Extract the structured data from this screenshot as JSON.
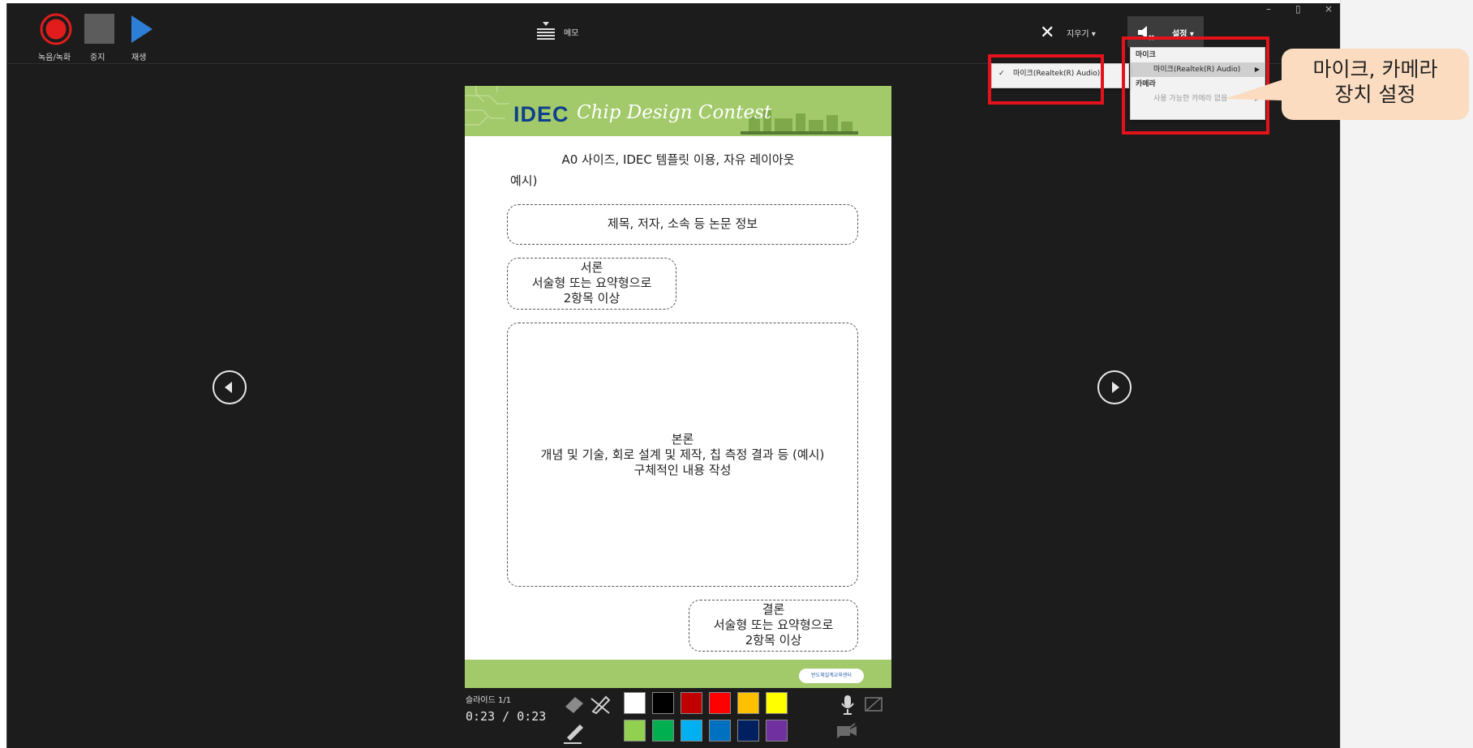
{
  "window": {
    "minimize": "–",
    "restore": "▯",
    "close": "×"
  },
  "toolbar": {
    "record_label": "녹음/녹화",
    "stop_label": "중지",
    "play_label": "재생",
    "memo_label": "메모",
    "clear_label": "지우기",
    "settings_label": "설정"
  },
  "settings_menu": {
    "mic_header": "마이크",
    "mic_item": "마이크(Realtek(R) Audio)",
    "camera_header": "카메라",
    "camera_item": "사용 가능한 카메라 없음"
  },
  "mic_submenu": {
    "checkmark": "✓",
    "item": "마이크(Realtek(R) Audio)"
  },
  "callout": {
    "line1": "마이크, 카메라",
    "line2": "장치 설정"
  },
  "slide": {
    "logo": "IDEC",
    "contest": "Chip Design Contest",
    "heading": "A0 사이즈, IDEC 템플릿 이용, 자유 레이아웃",
    "example": "예시)",
    "box_title": "제목, 저자, 소속 등 논문 정보",
    "intro": [
      "서론",
      "서술형 또는 요약형으로",
      "2항목 이상"
    ],
    "body": [
      "본론",
      "개념 및 기술, 회로 설계 및 제작, 칩 측정 결과 등 (예시)",
      "구체적인 내용 작성"
    ],
    "conclusion": [
      "결론",
      "서술형 또는 요약형으로",
      "2항목 이상"
    ],
    "footer_org": "반도체설계교육센터"
  },
  "status": {
    "slide_counter": "슬라이드 1/1",
    "time": "0:23 / 0:23"
  },
  "colors": {
    "record": "#e21c1c",
    "play": "#2d7ed6",
    "palette_row1": [
      "#ffffff",
      "#000000",
      "#c00000",
      "#ff0000",
      "#ffc000",
      "#ffff00"
    ],
    "palette_row2": [
      "#92d050",
      "#00b050",
      "#00b0f0",
      "#0070c0",
      "#002060",
      "#7030a0"
    ],
    "highlight_box": "#e3121b",
    "callout": "#fbdcc0"
  },
  "icons": [
    "record-icon",
    "stop-icon",
    "play-icon",
    "memo-icon",
    "close-x-icon",
    "settings-icon",
    "prev-slide-icon",
    "next-slide-icon",
    "eraser-icon",
    "pen-off-icon",
    "pen-icon",
    "microphone-icon",
    "camera-off-icon",
    "video-off-icon"
  ]
}
